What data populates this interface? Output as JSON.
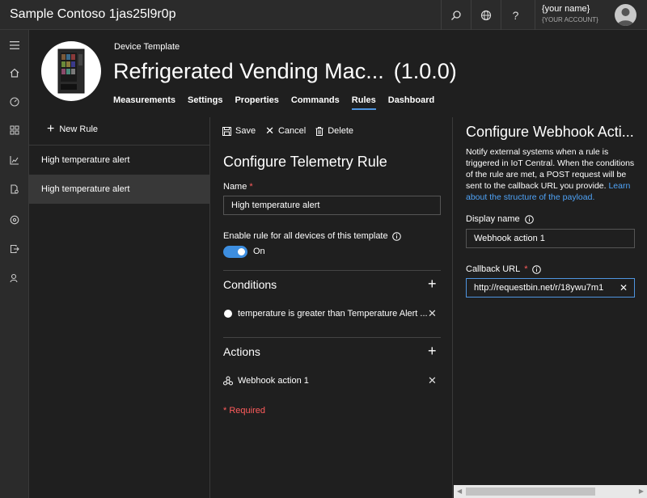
{
  "app": {
    "title": "Sample Contoso 1jas25l9r0p",
    "user_name": "{your name}",
    "user_account": "{YOUR ACCOUNT}"
  },
  "header": {
    "label": "Device Template",
    "title": "Refrigerated Vending Mac...",
    "version": "(1.0.0)",
    "tabs": [
      {
        "label": "Measurements",
        "active": false
      },
      {
        "label": "Settings",
        "active": false
      },
      {
        "label": "Properties",
        "active": false
      },
      {
        "label": "Commands",
        "active": false
      },
      {
        "label": "Rules",
        "active": true
      },
      {
        "label": "Dashboard",
        "active": false
      }
    ]
  },
  "rules": {
    "new_rule_label": "New Rule",
    "items": [
      {
        "label": "High temperature alert",
        "selected": false
      },
      {
        "label": "High temperature alert",
        "selected": true
      }
    ]
  },
  "config": {
    "toolbar": {
      "save": "Save",
      "cancel": "Cancel",
      "delete": "Delete"
    },
    "title": "Configure Telemetry Rule",
    "name_label": "Name",
    "name_required": "*",
    "name_value": "High temperature alert",
    "enable_label": "Enable rule for all devices of this template",
    "toggle_label": "On",
    "toggle_on": true,
    "conditions_title": "Conditions",
    "condition_text": "temperature is greater than Temperature Alert ...",
    "actions_title": "Actions",
    "action_text": "Webhook action 1",
    "required_note": "* Required"
  },
  "webhook": {
    "title": "Configure Webhook Acti...",
    "description": "Notify external systems when a rule is triggered in IoT Central. When the conditions of the rule are met, a POST request will be sent to the callback URL you provide.",
    "link_text": "Learn about the structure of the payload.",
    "display_name_label": "Display name",
    "display_name_value": "Webhook action 1",
    "callback_label": "Callback URL",
    "callback_required": "*",
    "callback_value": "http://requestbin.net/r/18ywu7m1"
  },
  "colors": {
    "accent": "#4f95e0",
    "required": "#ff5c5c",
    "link": "#4fa3f7"
  }
}
